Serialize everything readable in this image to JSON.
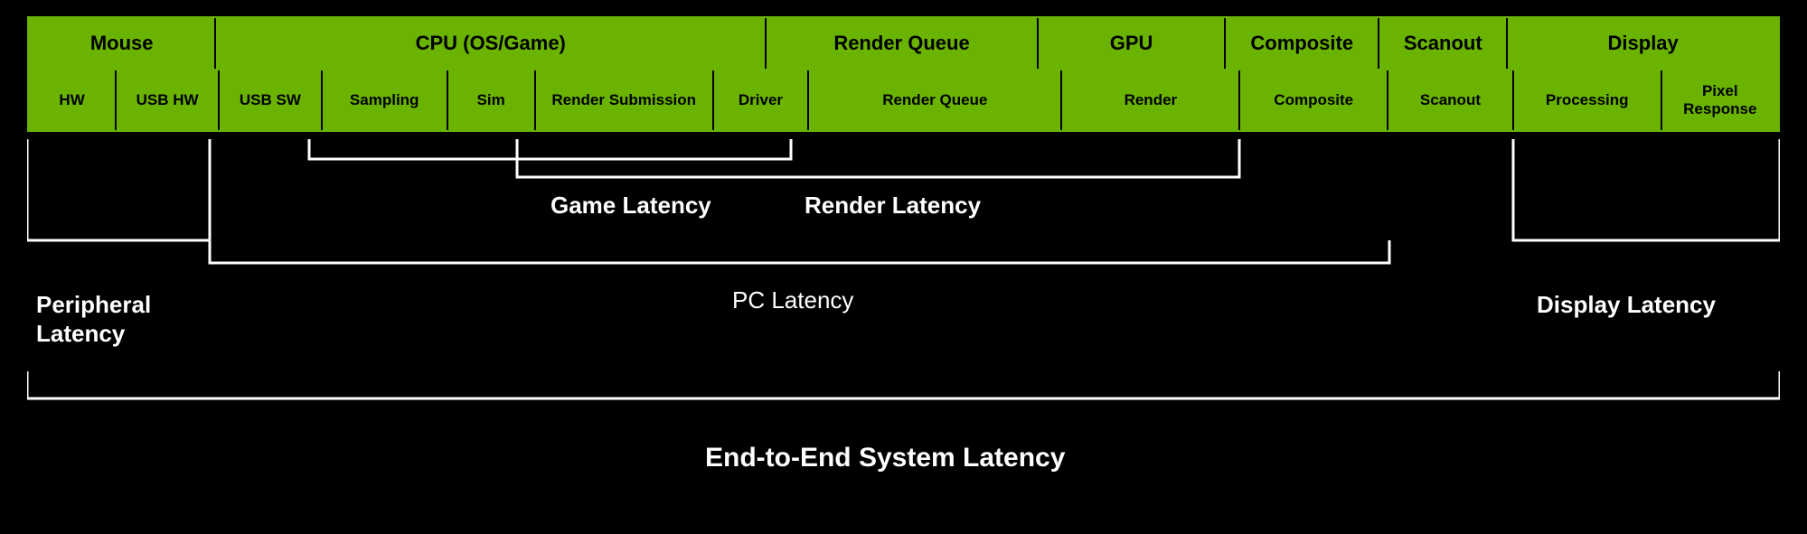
{
  "header": {
    "sections": [
      {
        "label": "Mouse",
        "flex": 2.2
      },
      {
        "label": "CPU (OS/Game)",
        "flex": 6.5
      },
      {
        "label": "Render Queue",
        "flex": 3.2
      },
      {
        "label": "GPU",
        "flex": 2.2
      },
      {
        "label": "Composite",
        "flex": 1.8
      },
      {
        "label": "Scanout",
        "flex": 1.5
      },
      {
        "label": "Display",
        "flex": 3.2
      }
    ],
    "subsections": [
      {
        "label": "HW",
        "flex": 1
      },
      {
        "label": "USB HW",
        "flex": 1.2
      },
      {
        "label": "USB SW",
        "flex": 1.2
      },
      {
        "label": "Sampling",
        "flex": 1.5
      },
      {
        "label": "Sim",
        "flex": 1
      },
      {
        "label": "Render Submission",
        "flex": 2.2
      },
      {
        "label": "Driver",
        "flex": 1.1
      },
      {
        "label": "Render Queue",
        "flex": 3.2
      },
      {
        "label": "Render",
        "flex": 2.2
      },
      {
        "label": "Composite",
        "flex": 1.8
      },
      {
        "label": "Scanout",
        "flex": 1.5
      },
      {
        "label": "Processing",
        "flex": 1.8
      },
      {
        "label": "Pixel Response",
        "flex": 1.4
      }
    ]
  },
  "latency_labels": {
    "game": "Game Latency",
    "render": "Render Latency",
    "peripheral": "Peripheral\nLatency",
    "pc": "PC Latency",
    "display": "Display Latency",
    "end_to_end": "End-to-End System Latency"
  },
  "colors": {
    "green": "#6ab300",
    "black": "#000000",
    "white": "#ffffff"
  }
}
